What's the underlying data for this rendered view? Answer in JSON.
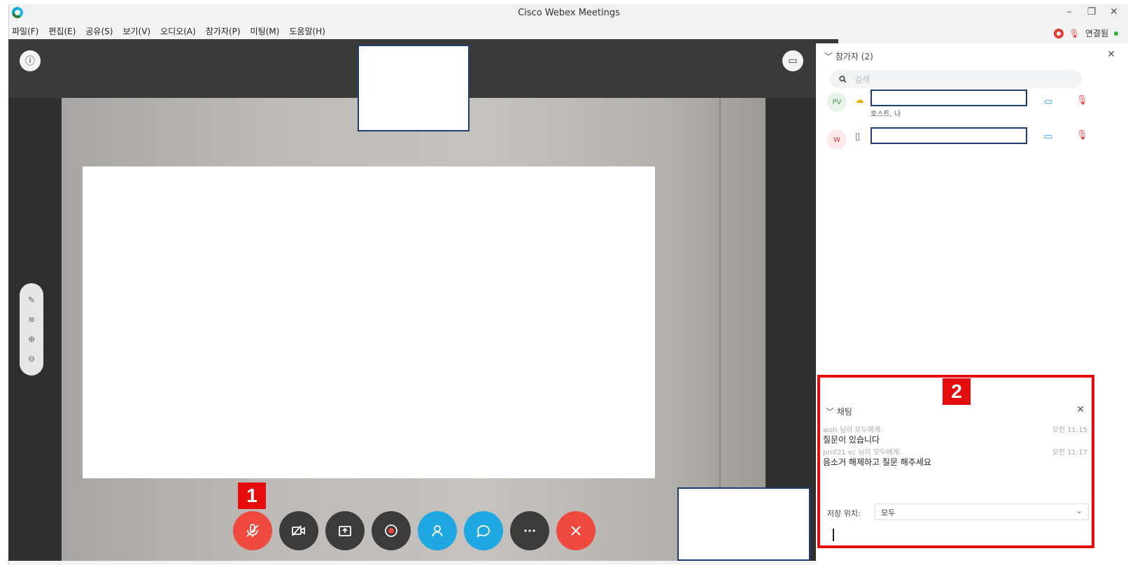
{
  "window": {
    "title": "Cisco Webex Meetings"
  },
  "menu": [
    "파일(F)",
    "편집(E)",
    "공유(S)",
    "보기(V)",
    "오디오(A)",
    "참가자(P)",
    "미팅(M)",
    "도움말(H)"
  ],
  "status": {
    "connection_label": "연결됨"
  },
  "stage": {
    "controls": [
      "mute",
      "video",
      "share",
      "record",
      "participants",
      "chat",
      "more",
      "leave"
    ]
  },
  "badges": {
    "one": "1",
    "two": "2"
  },
  "participants_panel": {
    "title": "참가자 (2)",
    "search_placeholder": "검색",
    "items": [
      {
        "avatar": "PV",
        "subtitle": "호스트, 나"
      },
      {
        "avatar": "W",
        "subtitle": ""
      }
    ]
  },
  "chat_panel": {
    "title": "채팅",
    "messages": [
      {
        "from": "woh 님이 모두에게:",
        "time": "오전 11:15",
        "text": "질문이 있습니다"
      },
      {
        "from": "prof21 vc 님이 모두에게:",
        "time": "오전 11:17",
        "text": "음소거  해제하고 질문 해주세요"
      }
    ],
    "to_label": "저장 위치:",
    "to_value": "모두"
  },
  "colors": {
    "accent_blue": "#1ea7e1",
    "alert_red": "#f04a3e",
    "badge_red": "#e40c0c"
  }
}
